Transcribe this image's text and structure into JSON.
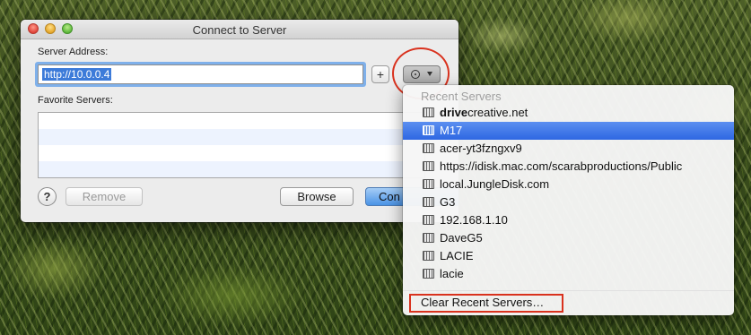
{
  "window": {
    "title": "Connect to Server",
    "server_address_label": "Server Address:",
    "server_address_value": "http://10.0.0.4",
    "add_favorite_label": "+",
    "favorite_servers_label": "Favorite Servers:",
    "favorites": [],
    "help_label": "?",
    "remove_label": "Remove",
    "browse_label": "Browse",
    "connect_label": "Con"
  },
  "recent_menu": {
    "header": "Recent Servers",
    "items": [
      {
        "bold": "drive",
        "rest": "creative.net",
        "selected": false
      },
      {
        "bold": "",
        "rest": "M17",
        "selected": true
      },
      {
        "bold": "",
        "rest": "acer-yt3fzngxv9",
        "selected": false
      },
      {
        "bold": "",
        "rest": "https://idisk.mac.com/scarabproductions/Public",
        "selected": false
      },
      {
        "bold": "",
        "rest": "local.JungleDisk.com",
        "selected": false
      },
      {
        "bold": "",
        "rest": "G3",
        "selected": false
      },
      {
        "bold": "",
        "rest": "192.168.1.10",
        "selected": false
      },
      {
        "bold": "",
        "rest": "DaveG5",
        "selected": false
      },
      {
        "bold": "",
        "rest": "LACIE",
        "selected": false
      },
      {
        "bold": "",
        "rest": "lacie",
        "selected": false
      }
    ],
    "clear_label": "Clear Recent Servers…"
  },
  "icons": {
    "recent_button": "clock-icon",
    "dropdown": "caret-down-icon",
    "server": "network-server-icon"
  },
  "colors": {
    "selection": "#2e67e2",
    "annotation": "#d9321e"
  }
}
